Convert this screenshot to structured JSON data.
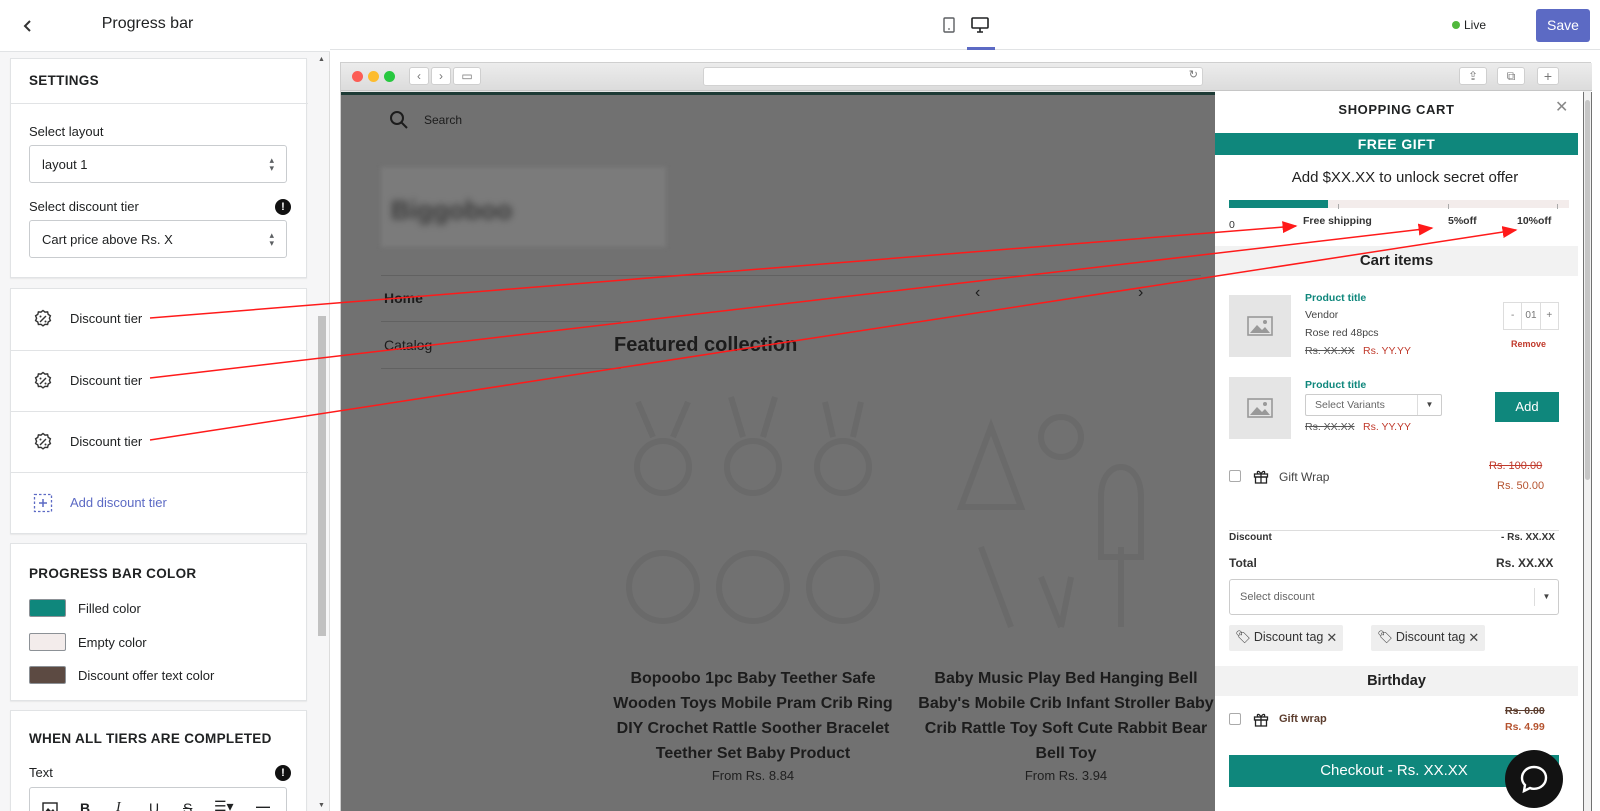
{
  "left_panel": {
    "title": "Progress bar",
    "settings": {
      "heading": "SETTINGS",
      "layout_label": "Select layout",
      "layout_value": "layout 1",
      "tier_label": "Select discount tier",
      "tier_value": "Cart price above Rs. X"
    },
    "tiers": [
      {
        "label": "Discount tier"
      },
      {
        "label": "Discount tier"
      },
      {
        "label": "Discount tier"
      }
    ],
    "add_tier_label": "Add discount tier",
    "color_section": {
      "heading": "PROGRESS BAR COLOR",
      "colors": [
        {
          "label": "Filled color",
          "value": "#0f877c"
        },
        {
          "label": "Empty color",
          "value": "#f3eceb"
        },
        {
          "label": "Discount offer text color",
          "value": "#5c4a42"
        }
      ]
    },
    "completed_section": {
      "heading": "WHEN ALL TIERS ARE COMPLETED",
      "text_label": "Text",
      "toolbar_icons": [
        "image-icon",
        "bold-icon",
        "italic-icon",
        "underline-icon",
        "strikethrough-icon",
        "align-icon",
        "horizontal-rule-icon"
      ]
    }
  },
  "topbar": {
    "devices": [
      "mobile-icon",
      "desktop-icon"
    ],
    "active_device": "desktop",
    "status": "Live",
    "status_color": "#50b83c",
    "save_label": "Save",
    "accent": "#5c6ac4"
  },
  "store": {
    "search": "Search",
    "nav": [
      "Home",
      "Catalog"
    ],
    "featured_heading": "Featured collection",
    "products": [
      {
        "name": "Bopoobo 1pc Baby Teether Safe Wooden Toys Mobile Pram Crib Ring DIY Crochet Rattle Soother Bracelet Teether Set Baby Product",
        "price": "From Rs. 8.84"
      },
      {
        "name": "Baby Music Play Bed Hanging Bell Baby's Mobile Crib Infant Stroller Baby Crib Rattle Toy Soft Cute Rabbit Bear Bell Toy",
        "price": "From Rs. 3.94"
      }
    ]
  },
  "cart": {
    "title": "SHOPPING CART",
    "free_gift": "FREE GIFT",
    "unlock_text": "Add $XX.XX to unlock secret offer",
    "progress": 0.29,
    "milestones": [
      "0",
      "Free shipping",
      "5%off",
      "10%off"
    ],
    "items_heading": "Cart items",
    "items": [
      {
        "title": "Product title",
        "vendor": "Vendor",
        "variant": "Rose red 48pcs",
        "old_price": "Rs. XX.XX",
        "new_price": "Rs. YY.YY",
        "qty": "01",
        "qty_minus": "-",
        "qty_plus": "+",
        "remove": "Remove"
      },
      {
        "title": "Product title",
        "variant_placeholder": "Select Variants",
        "old_price": "Rs. XX.XX",
        "new_price": "Rs. YY.YY",
        "add_label": "Add"
      }
    ],
    "gift_wrap": {
      "label": "Gift Wrap",
      "old_price": "Rs. 100.00",
      "new_price": "Rs. 50.00"
    },
    "summary": {
      "discount_label": "Discount",
      "discount_value": "- Rs. XX.XX",
      "total_label": "Total",
      "total_value": "Rs. XX.XX"
    },
    "discount_placeholder": "Select discount",
    "tags": [
      "Discount tag",
      "Discount tag"
    ],
    "birthday_heading": "Birthday",
    "birthday_gift": {
      "label": "Gift wrap",
      "old_price": "Rs. 0.00",
      "new_price": "Rs. 4.99"
    },
    "checkout_label": "Checkout - Rs. XX.XX",
    "primary_color": "#0f877c"
  }
}
